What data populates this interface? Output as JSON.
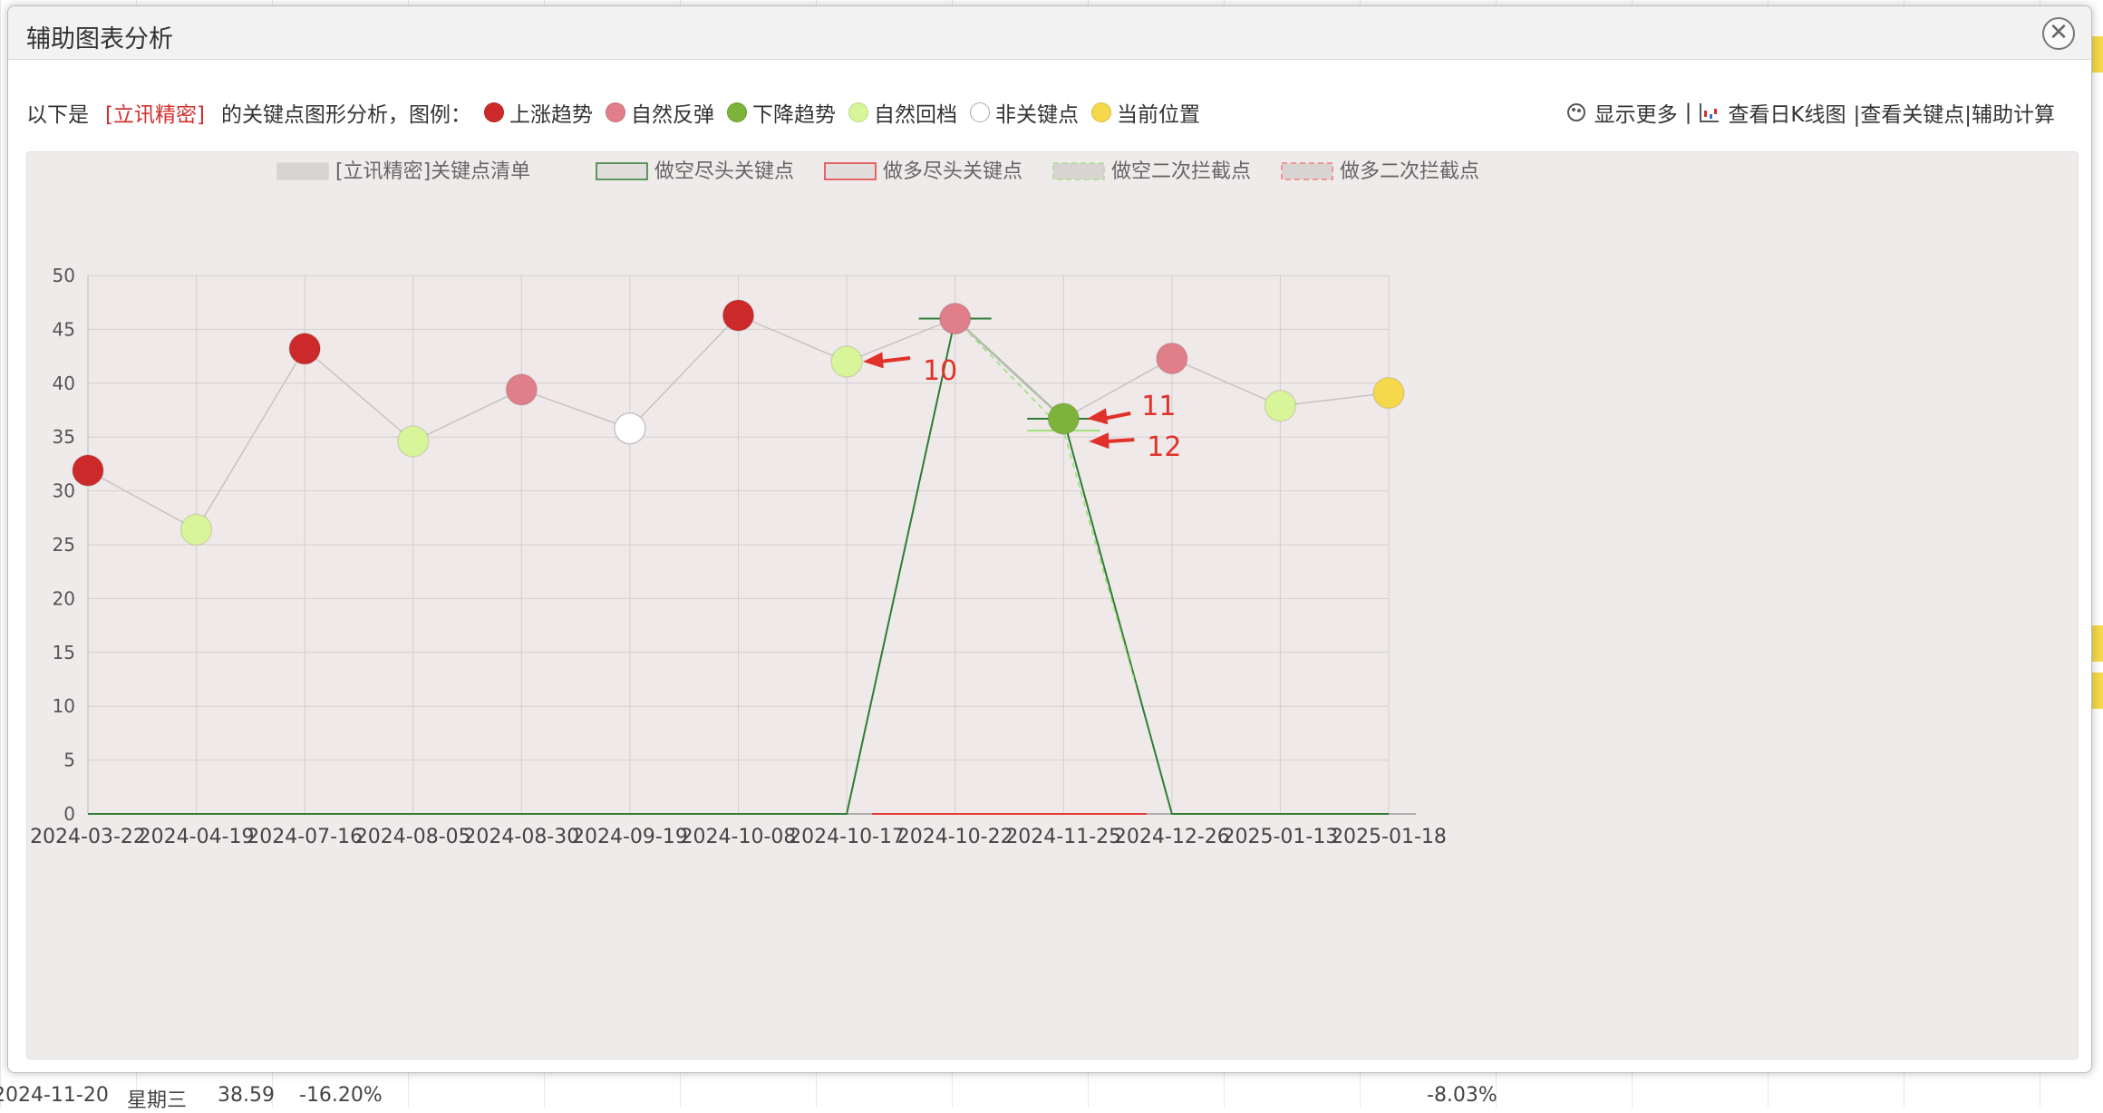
{
  "dialog": {
    "title": "辅助图表分析",
    "close_icon": "close-icon"
  },
  "legend_bar": {
    "prefix": "以下是",
    "stock_name": "[立讯精密]",
    "suffix": "的关键点图形分析，图例：",
    "items": [
      {
        "label": "上涨趋势",
        "color": "#cc2a2a"
      },
      {
        "label": "自然反弹",
        "color": "#e07f8a"
      },
      {
        "label": "下降趋势",
        "color": "#7db33a"
      },
      {
        "label": "自然回档",
        "color": "#d8f59a"
      },
      {
        "label": "非关键点",
        "color": "#ffffff"
      },
      {
        "label": "当前位置",
        "color": "#f5d84c"
      }
    ]
  },
  "toolbar": {
    "show_more": "显示更多",
    "separator": "|",
    "daily_k": "查看日K线图",
    "view_keypoints": "|查看关键点",
    "calc": "|辅助计算"
  },
  "background": {
    "bottom_row": {
      "date": "2024-11-20",
      "weekday": "星期三",
      "price": "38.59",
      "pct": "-16.20%",
      "pct2": "-8.03%"
    }
  },
  "chart_data": {
    "type": "line",
    "series_legend": [
      {
        "name": "[立讯精密]关键点清单",
        "color": "#cfcfcf"
      },
      {
        "name": "做空尽头关键点",
        "color": "#2e7d32"
      },
      {
        "name": "做多尽头关键点",
        "color": "#e53935"
      },
      {
        "name": "做空二次拦截点",
        "color": "#a5e08a"
      },
      {
        "name": "做多二次拦截点",
        "color": "#f08080"
      }
    ],
    "categories": [
      "2024-03-22",
      "2024-04-19",
      "2024-07-16",
      "2024-08-05",
      "2024-08-30",
      "2024-09-19",
      "2024-10-08",
      "2024-10-17",
      "2024-10-22",
      "2024-11-25",
      "2024-12-26",
      "2025-01-13",
      "2025-01-18"
    ],
    "ylim": [
      0,
      50
    ],
    "yticks": [
      0,
      5,
      10,
      15,
      20,
      25,
      30,
      35,
      40,
      45,
      50
    ],
    "grid": true,
    "legend_position": "top",
    "series": [
      {
        "name": "[立讯精密]关键点清单",
        "values": [
          31.9,
          26.4,
          43.2,
          34.6,
          39.4,
          35.8,
          46.3,
          42.0,
          46.0,
          36.7,
          42.3,
          37.9,
          39.1
        ],
        "point_types": [
          "上涨趋势",
          "自然回档",
          "上涨趋势",
          "自然回档",
          "自然反弹",
          "非关键点",
          "上涨趋势",
          "自然回档",
          "自然反弹",
          "下降趋势",
          "自然反弹",
          "自然回档",
          "当前位置"
        ]
      },
      {
        "name": "做空尽头关键点",
        "values": [
          0,
          0,
          0,
          0,
          0,
          0,
          0,
          0,
          46.0,
          36.7,
          0,
          0,
          0
        ]
      },
      {
        "name": "做多尽头关键点",
        "values": [
          0,
          0,
          0,
          0,
          0,
          0,
          0,
          0,
          0,
          0,
          0,
          0,
          0
        ]
      },
      {
        "name": "做空二次拦截点",
        "values": [
          null,
          null,
          null,
          null,
          null,
          null,
          null,
          null,
          46.0,
          35.6,
          null,
          null,
          null
        ]
      }
    ],
    "annotations": [
      {
        "text": "10",
        "target_index": 7
      },
      {
        "text": "11",
        "target_index": 9
      },
      {
        "text": "12",
        "target_index": 9
      }
    ]
  }
}
